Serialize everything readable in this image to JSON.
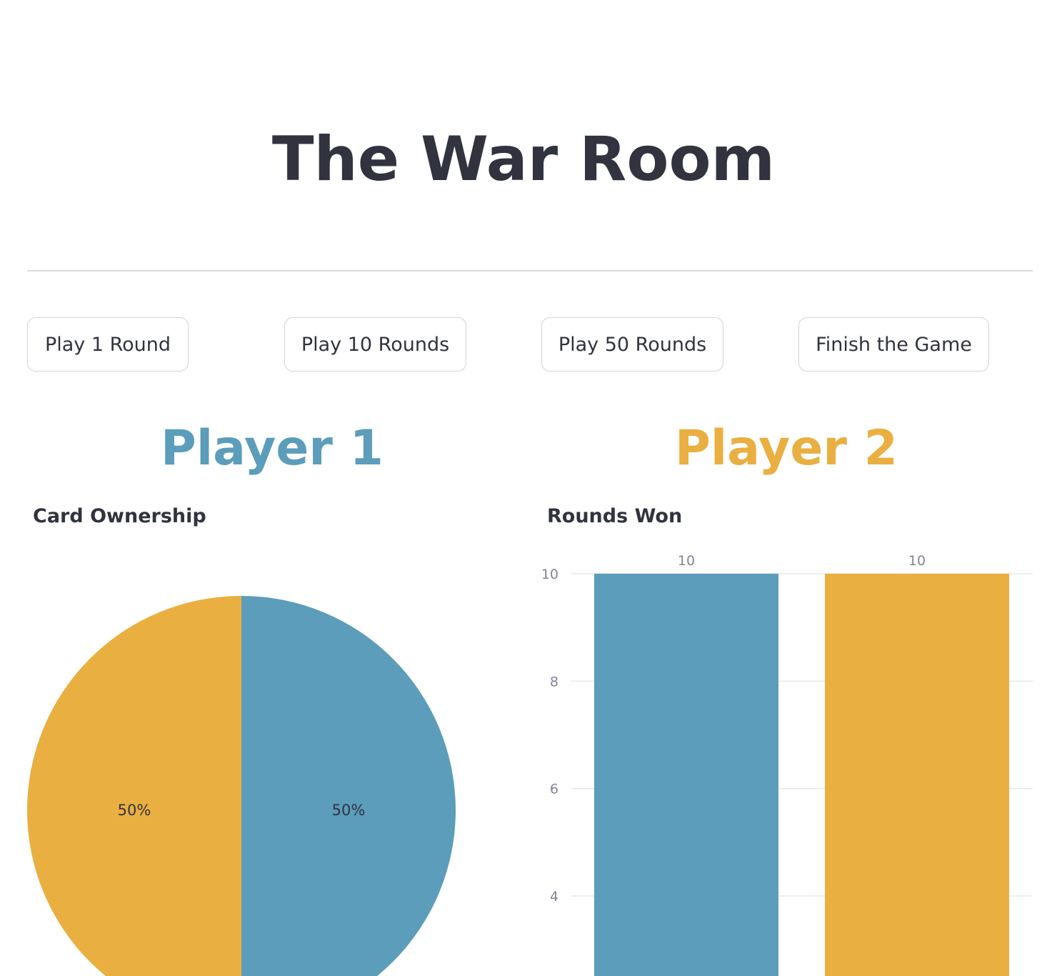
{
  "app": {
    "title": "The War Room"
  },
  "controls": {
    "play_1_label": "Play 1 Round",
    "play_10_label": "Play 10 Rounds",
    "play_50_label": "Play 50 Rounds",
    "finish_label": "Finish the Game"
  },
  "players": {
    "p1": {
      "name": "Player 1",
      "color": "#5b9dba"
    },
    "p2": {
      "name": "Player 2",
      "color": "#eaaf41"
    }
  },
  "charts": {
    "card_ownership_title": "Card Ownership",
    "rounds_won_title": "Rounds Won"
  },
  "chart_data": [
    {
      "type": "pie",
      "title": "Card Ownership",
      "slices": [
        {
          "value": 50,
          "label": "50%",
          "color": "#5b9dba"
        },
        {
          "value": 50,
          "label": "50%",
          "color": "#eaaf41"
        }
      ]
    },
    {
      "type": "bar",
      "title": "Rounds Won",
      "categories": [
        "",
        ""
      ],
      "values": [
        10,
        10
      ],
      "data_labels": [
        "10",
        "10"
      ],
      "colors": [
        "#5b9dba",
        "#eaaf41"
      ],
      "yticks": [
        "4",
        "6",
        "8",
        "10"
      ],
      "grid": true
    }
  ]
}
